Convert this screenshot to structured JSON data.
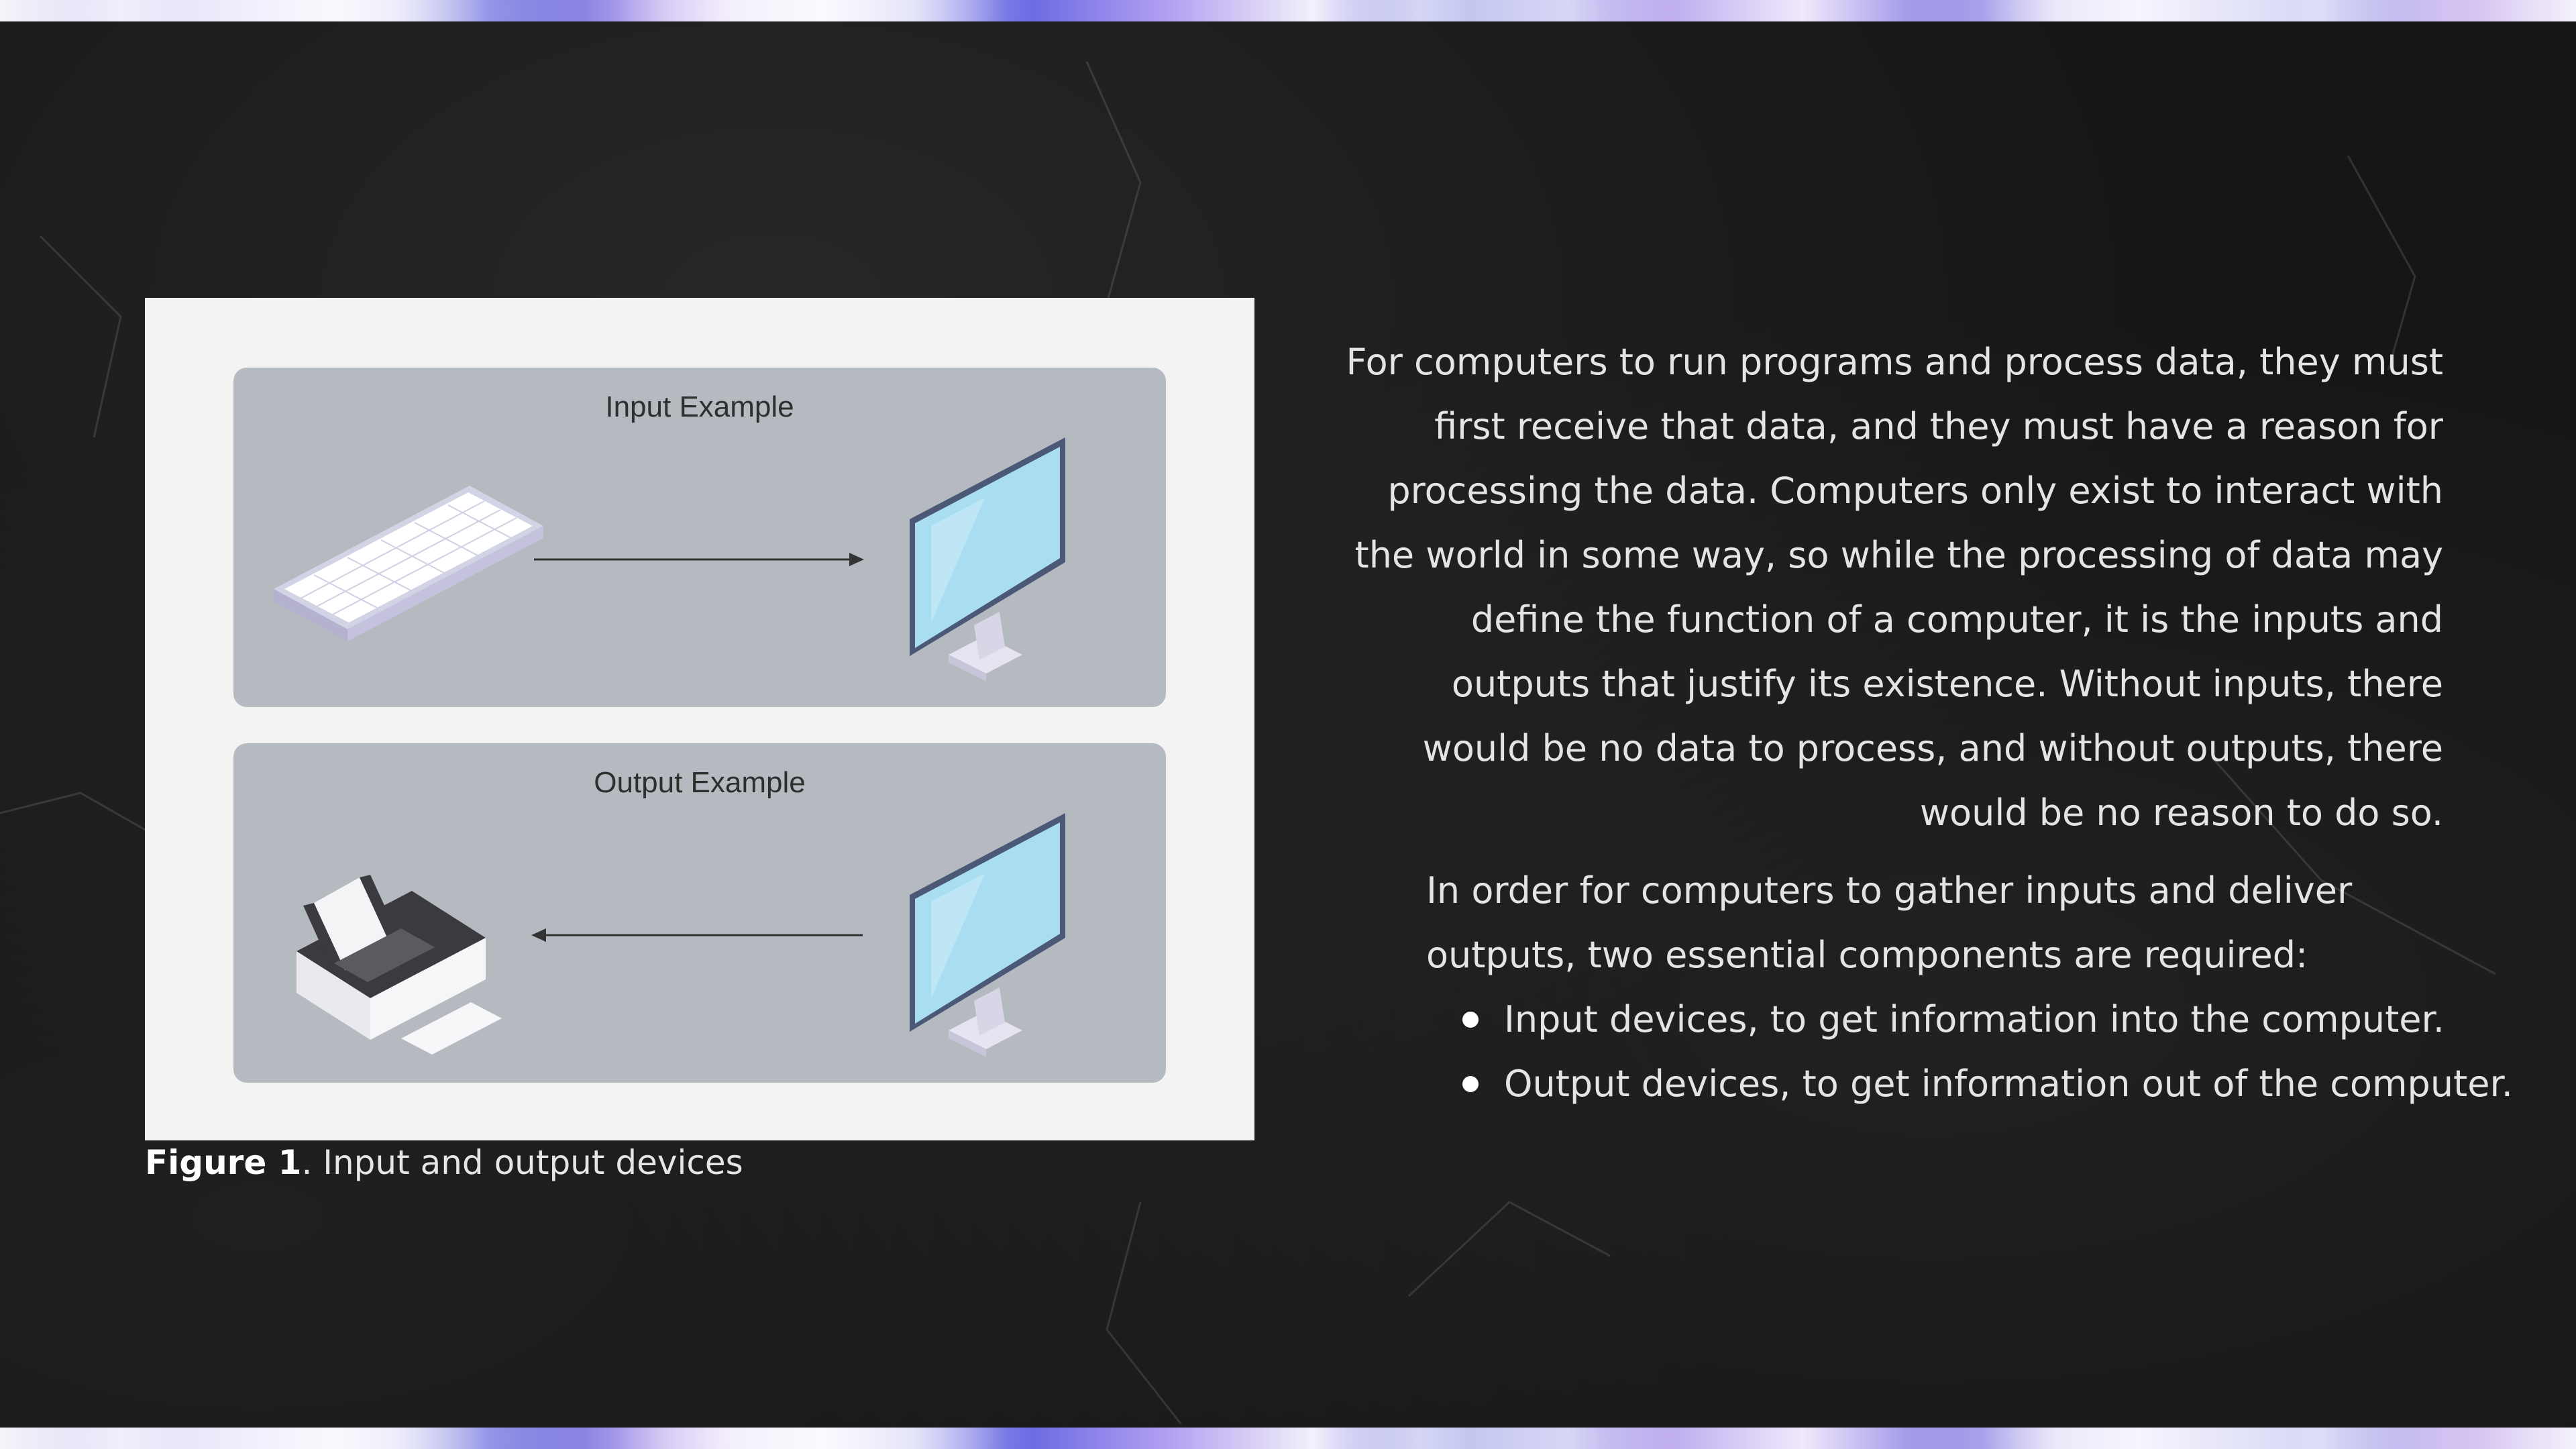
{
  "figure": {
    "input_title": "Input Example",
    "output_title": "Output Example",
    "caption_label": "Figure 1",
    "caption_text": ". Input and output devices"
  },
  "text": {
    "paragraph_1": "For computers to run programs and process data, they must first receive that data, and they must have a reason for processing the data. Computers only exist to interact with the world in some way, so while the processing of data may define the function of a computer, it is the inputs and outputs that justify its existence. Without inputs, there would be no data to process, and without outputs, there would be no reason to do so.",
    "paragraph_2": "In order for computers to gather inputs and deliver outputs, two essential components are required:",
    "bullets": [
      "Input devices, to get information into the computer.",
      "Output devices, to get information out of the computer."
    ]
  },
  "colors": {
    "background": "#161616",
    "card": "#f3f3f3",
    "example_box": "#b5bac0",
    "screen": "#a9def2",
    "text": "#e4e4e4"
  },
  "icons": [
    "keyboard-icon",
    "monitor-icon",
    "printer-icon",
    "arrow-right-icon",
    "arrow-left-icon"
  ]
}
